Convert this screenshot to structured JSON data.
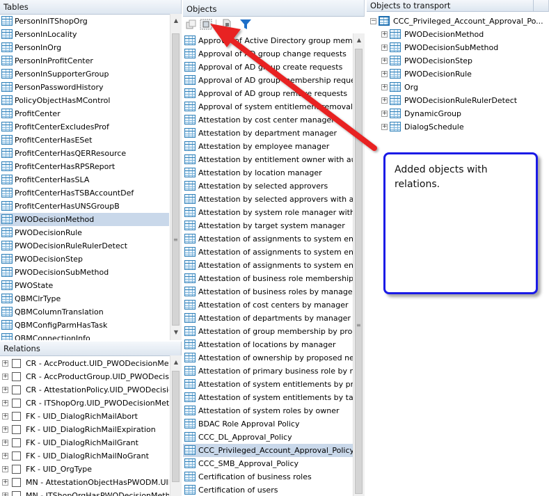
{
  "tables": {
    "title": "Tables",
    "items": [
      {
        "label": "PersonInITShopOrg",
        "selected": false
      },
      {
        "label": "PersonInLocality",
        "selected": false
      },
      {
        "label": "PersonInOrg",
        "selected": false
      },
      {
        "label": "PersonInProfitCenter",
        "selected": false
      },
      {
        "label": "PersonInSupporterGroup",
        "selected": false
      },
      {
        "label": "PersonPasswordHistory",
        "selected": false
      },
      {
        "label": "PolicyObjectHasMControl",
        "selected": false
      },
      {
        "label": "ProfitCenter",
        "selected": false
      },
      {
        "label": "ProfitCenterExcludesProf",
        "selected": false
      },
      {
        "label": "ProfitCenterHasESet",
        "selected": false
      },
      {
        "label": "ProfitCenterHasQERResource",
        "selected": false
      },
      {
        "label": "ProfitCenterHasRPSReport",
        "selected": false
      },
      {
        "label": "ProfitCenterHasSLA",
        "selected": false
      },
      {
        "label": "ProfitCenterHasTSBAccountDef",
        "selected": false
      },
      {
        "label": "ProfitCenterHasUNSGroupB",
        "selected": false
      },
      {
        "label": "PWODecisionMethod",
        "selected": true
      },
      {
        "label": "PWODecisionRule",
        "selected": false
      },
      {
        "label": "PWODecisionRuleRulerDetect",
        "selected": false
      },
      {
        "label": "PWODecisionStep",
        "selected": false
      },
      {
        "label": "PWODecisionSubMethod",
        "selected": false
      },
      {
        "label": "PWOState",
        "selected": false
      },
      {
        "label": "QBMClrType",
        "selected": false
      },
      {
        "label": "QBMColumnTranslation",
        "selected": false
      },
      {
        "label": "QBMConfigParmHasTask",
        "selected": false
      },
      {
        "label": "QBMConnectionInfo",
        "selected": false
      }
    ]
  },
  "relations": {
    "title": "Relations",
    "items": [
      {
        "label": "CR - AccProduct.UID_PWODecisionMethod"
      },
      {
        "label": "CR - AccProductGroup.UID_PWODecisionMe"
      },
      {
        "label": "CR - AttestationPolicy.UID_PWODecisionM"
      },
      {
        "label": "CR - ITShopOrg.UID_PWODecisionMethod"
      },
      {
        "label": "FK - UID_DialogRichMailAbort"
      },
      {
        "label": "FK - UID_DialogRichMailExpiration"
      },
      {
        "label": "FK - UID_DialogRichMailGrant"
      },
      {
        "label": "FK - UID_DialogRichMailNoGrant"
      },
      {
        "label": "FK - UID_OrgType"
      },
      {
        "label": "MN - AttestationObjectHasPWODM.UID_P"
      },
      {
        "label": "MN - ITShopOrgHasPWODecisionMethod.U"
      }
    ]
  },
  "objects": {
    "title": "Objects",
    "items": [
      {
        "label": "Approval of Active Directory group membership",
        "selected": false
      },
      {
        "label": "Approval of AD group change requests",
        "selected": false
      },
      {
        "label": "Approval of AD group create requests",
        "selected": false
      },
      {
        "label": "Approval of AD group membership requests",
        "selected": false
      },
      {
        "label": "Approval of AD group remove requests",
        "selected": false
      },
      {
        "label": "Approval of system entitlement removal reque",
        "selected": false
      },
      {
        "label": "Attestation by cost center manager",
        "selected": false
      },
      {
        "label": "Attestation by department manager",
        "selected": false
      },
      {
        "label": "Attestation by employee manager",
        "selected": false
      },
      {
        "label": "Attestation by entitlement owner with auto-re",
        "selected": false
      },
      {
        "label": "Attestation by location manager",
        "selected": false
      },
      {
        "label": "Attestation by selected approvers",
        "selected": false
      },
      {
        "label": "Attestation by selected approvers with auto-r",
        "selected": false
      },
      {
        "label": "Attestation by system role manager with auto",
        "selected": false
      },
      {
        "label": "Attestation by target system manager",
        "selected": false
      },
      {
        "label": "Attestation of assignments to system entitlem",
        "selected": false
      },
      {
        "label": "Attestation of assignments to system entitlem",
        "selected": false
      },
      {
        "label": "Attestation of assignments to system entitlem",
        "selected": false
      },
      {
        "label": "Attestation of business role membership by rol",
        "selected": false
      },
      {
        "label": "Attestation of business roles by manager",
        "selected": false
      },
      {
        "label": "Attestation of cost centers by manager",
        "selected": false
      },
      {
        "label": "Attestation of departments by manager",
        "selected": false
      },
      {
        "label": "Attestation of group membership by product o",
        "selected": false
      },
      {
        "label": "Attestation of locations by manager",
        "selected": false
      },
      {
        "label": "Attestation of ownership by proposed new ow",
        "selected": false
      },
      {
        "label": "Attestation of primary business role by role m.",
        "selected": false
      },
      {
        "label": "Attestation of system entitlements by product",
        "selected": false
      },
      {
        "label": "Attestation of system entitlements by target s",
        "selected": false
      },
      {
        "label": "Attestation of system roles by owner",
        "selected": false
      },
      {
        "label": "BDAC Role Approval Policy",
        "selected": false
      },
      {
        "label": "CCC_DL_Approval_Policy",
        "selected": false
      },
      {
        "label": "CCC_Privileged_Account_Approval_Policy",
        "selected": true
      },
      {
        "label": "CCC_SMB_Approval_Policy",
        "selected": false
      },
      {
        "label": "Certification of business roles",
        "selected": false
      },
      {
        "label": "Certification of users",
        "selected": false
      }
    ]
  },
  "transport": {
    "title": "Objects to transport",
    "root": "CCC_Privileged_Account_Approval_Po...",
    "children": [
      {
        "label": "PWODecisionMethod"
      },
      {
        "label": "PWODecisionSubMethod"
      },
      {
        "label": "PWODecisionStep"
      },
      {
        "label": "PWODecisionRule"
      },
      {
        "label": "Org"
      },
      {
        "label": "PWODecisionRuleRulerDetect"
      },
      {
        "label": "DynamicGroup"
      },
      {
        "label": "DialogSchedule"
      }
    ]
  },
  "callout": {
    "text": "Added objects with relations."
  },
  "colors": {
    "accent": "#1a1ae6",
    "arrow": "#e82020",
    "selection": "#c9d8ea",
    "tableIcon": "#2e7fb8"
  }
}
